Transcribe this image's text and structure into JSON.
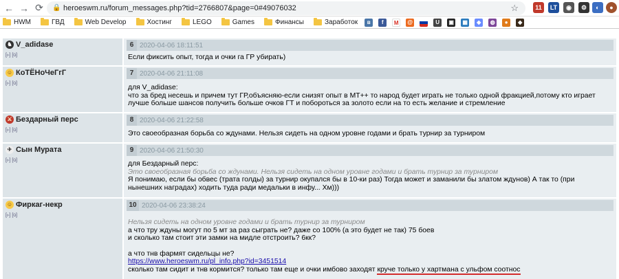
{
  "browser": {
    "url": "heroeswm.ru/forum_messages.php?tid=2766807&page=0#49076032",
    "ext_badge": "11"
  },
  "bookmarks": [
    "HWM",
    "ГВД",
    "Web Develop",
    "Хостинг",
    "LEGO",
    "Games",
    "Финансы",
    "Заработок"
  ],
  "posts": [
    {
      "author": "V_adidase",
      "links": "[▹] [ü]",
      "num": "6",
      "date": "2020-04-06 18:11:51",
      "lines": [
        "Если фиксить опыт, тогда и очки га ГР убирать)"
      ]
    },
    {
      "author": "КоТЁНоЧеГгГ",
      "links": "[▹] [ü]",
      "num": "7",
      "date": "2020-04-06 21:11:08",
      "lines": [
        "для V_adidase:",
        "что за бред несешь и причем тут ГР,объясняю-если снизят опыт в МТ++ то народ будет играть не только одной фракцией,потому кто играет",
        "лучше больше шансов получить больше очков ГТ и побороться за золото если на то есть желание и стремление"
      ]
    },
    {
      "author": "Бездарный перс",
      "links": "[▹] [ü]",
      "num": "8",
      "date": "2020-04-06 21:22:58",
      "lines": [
        "Это своеобразная борьба со ждунами. Нельзя сидеть на одном уровне годами и брать турнир за турниром"
      ]
    },
    {
      "author": "Сын Мурата",
      "links": "[▹] [ü]",
      "num": "9",
      "date": "2020-04-06 21:50:30",
      "line1": "для Бездарный перс:",
      "quote": "Это своеобразная борьба со ждунами. Нельзя сидеть на одном уровне годами и брать турнир за турниром",
      "line2": "Я понимаю, если бы обвес (трата голды) за турнир окупался бы в 10-ки раз) Тогда может и заманили бы златом ждунов) А так то (при",
      "line3": "нынешних наградах) ходить туда ради медальки в инфу... Хм)))"
    },
    {
      "author": "Фиркаг-некр",
      "links": "[▹] [ü]",
      "num": "10",
      "date": "2020-04-06 23:38:24",
      "quote": "Нельзя сидеть на одном уровне годами и брать турнир за турниром",
      "line1": "а что тру ждуны могут по 5 мт за раз сыграть не? даже со 100% (а это будет не так) 75 боев",
      "line2": "и сколько там стоит эти замки на мидле отстроить? 6кк?",
      "line3": "а что тнв фармят сидельцы не?",
      "link": "https://www.heroeswm.ru/pl_info.php?id=3451514",
      "line4a": "сколько там сидит и тнв кормится? только там еще и очки имбово заходят ",
      "line4b": "круче только у хартмана с ульфом соотнос"
    }
  ]
}
